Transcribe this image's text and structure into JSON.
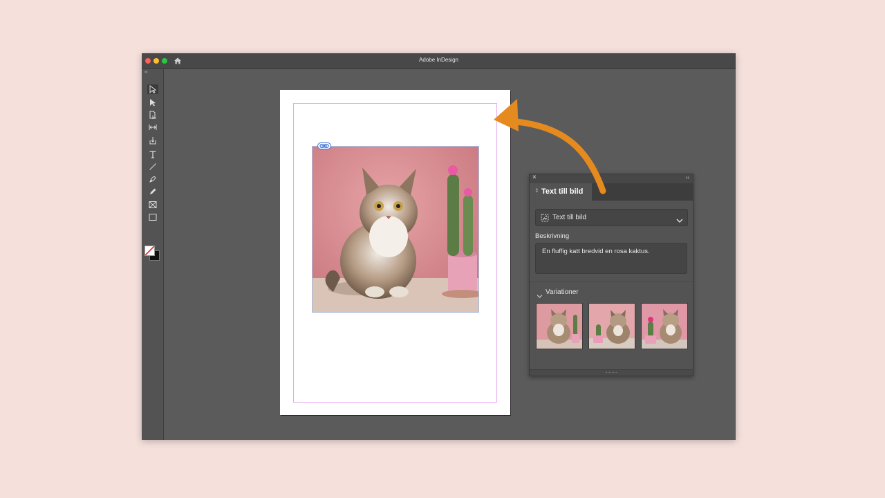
{
  "app": {
    "title": "Adobe InDesign"
  },
  "toolbar": {
    "tools": [
      "selection-tool",
      "direct-selection-tool",
      "page-tool",
      "gap-tool",
      "content-collector-tool",
      "type-tool",
      "line-tool",
      "pen-tool",
      "pencil-tool",
      "rectangle-frame-tool",
      "rectangle-tool"
    ],
    "active_tool": "selection-tool",
    "fill": "none",
    "stroke": "#111111"
  },
  "document": {
    "image_link_badge": "link-icon"
  },
  "panel": {
    "tab_title": "Text till bild",
    "mode_dropdown": {
      "selected": "Text till bild"
    },
    "description_label": "Beskrivning",
    "description_value": "En fluffig katt bredvid en rosa kaktus.",
    "variations_label": "Variationer",
    "variation_count": 3
  },
  "colors": {
    "background": "#f5e0dc",
    "workspace": "#5b5b5b",
    "margin_guide": "#e8a6ef",
    "arrow": "#e58a1f"
  }
}
